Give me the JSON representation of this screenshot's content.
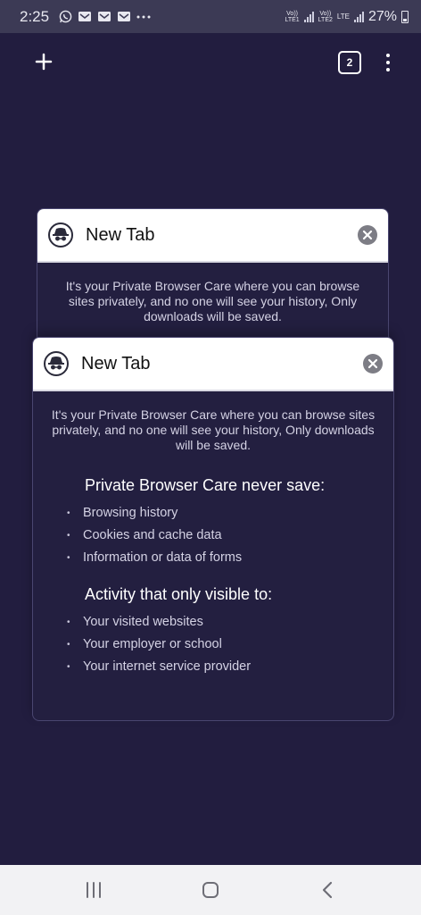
{
  "status_bar": {
    "time": "2:25",
    "more_icon": "ellipsis-icon",
    "sim1_label_top": "Vo))",
    "sim1_label_bottom": "LTE1",
    "sim2_label_top": "Vo))",
    "sim2_label_bottom": "LTE2",
    "sim2_net": "LTE",
    "battery": "27%"
  },
  "toolbar": {
    "new_tab_icon": "plus-icon",
    "tab_count": "2",
    "menu_icon": "more-vertical-icon"
  },
  "tabs": [
    {
      "title": "New Tab",
      "intro": "It's your Private Browser Care where you can browse sites privately, and no one will see your history, Only downloads will be saved."
    },
    {
      "title": "New Tab",
      "intro": "It's your Private Browser Care where you can browse sites privately, and no one will see your history, Only downloads will be saved.",
      "section1_title": "Private Browser Care never save:",
      "section1_items": [
        "Browsing history",
        "Cookies and cache data",
        "Information or data of forms"
      ],
      "section2_title": "Activity that only visible to:",
      "section2_items": [
        "Your visited websites",
        "Your employer or school",
        "Your internet service provider"
      ]
    }
  ],
  "nav": {
    "recents_icon": "recent-apps-icon",
    "home_icon": "home-icon",
    "back_icon": "back-icon"
  },
  "colors": {
    "background": "#221d3f",
    "status_bar": "#3c3a55",
    "nav_bar": "#f2f2f4"
  }
}
